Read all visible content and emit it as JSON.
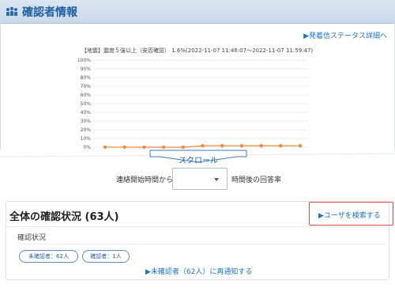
{
  "header": {
    "title": "確認者情報",
    "icon": "people-group-icon"
  },
  "links": {
    "delivery_status": "▶発着信ステータス詳細へ"
  },
  "chart_data": {
    "type": "line",
    "title": "【地震】震度５強以上（安否確認） 1.6%(2022-11-07 11:46:07〜2022-11-07 11:59:47)",
    "y_ticks": [
      "100%",
      "90%",
      "80%",
      "70%",
      "60%",
      "50%",
      "40%",
      "30%",
      "20%",
      "10%",
      "0%"
    ],
    "ylim": [
      0,
      100
    ],
    "series": [
      {
        "values": [
          0,
          0,
          0,
          0,
          0,
          1.6,
          1.6,
          1.6,
          1.6,
          1.6,
          1.6
        ]
      }
    ],
    "grid": true,
    "line_color": "#f08a3c"
  },
  "scroll_label": "スクロール",
  "filter": {
    "prefix": "連絡開始時間から",
    "select_value": "",
    "suffix": "時間後の回答率"
  },
  "card": {
    "title": "全体の確認状況 (63人)",
    "search_link": "▶ユーザを検索する",
    "status_label": "確認状況",
    "pills": [
      "未確認者：62人",
      "確認者：1人"
    ],
    "notify_link": "▶未確認者（62人）に再通知する"
  }
}
